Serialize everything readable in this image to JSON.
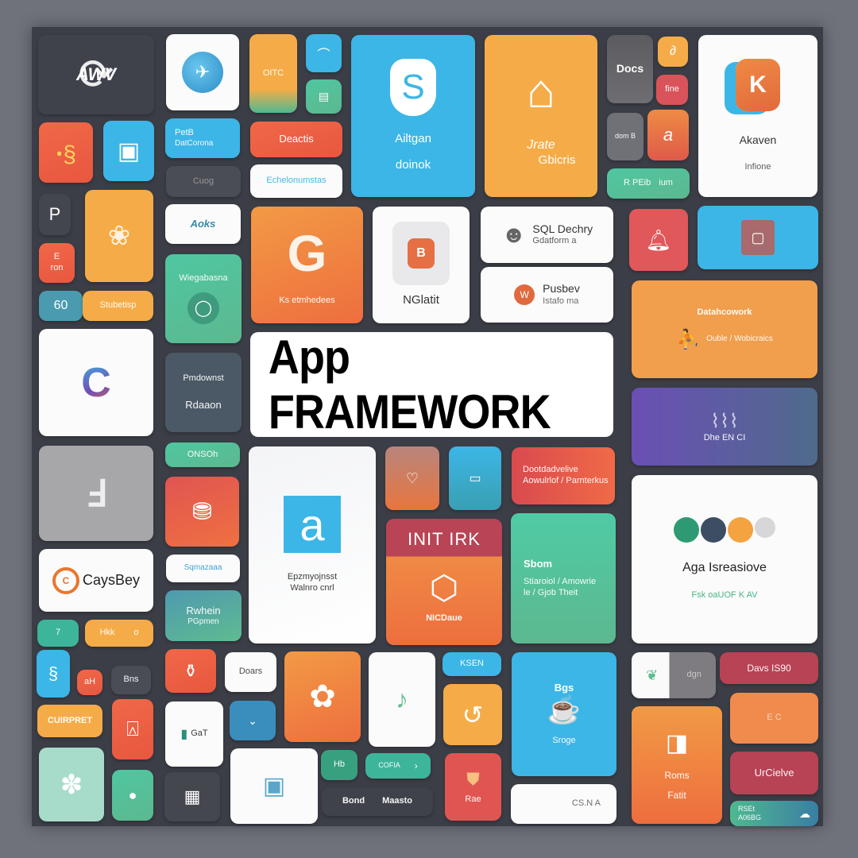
{
  "title": "App FRAMEWORK",
  "colors": {
    "background": "#6f717b",
    "panel": "#3c3e47",
    "orange": "#ee6e3e",
    "yellow": "#f5ac48",
    "blue": "#3cb6e6",
    "green": "#4fc7a1",
    "crimson": "#b74355",
    "white": "#fbfbfb"
  },
  "tiles": {
    "awv_logo": {
      "label": "AWV",
      "icon": "refresh-cycle-icon"
    },
    "globe_app": {
      "icon": "globe-icon"
    },
    "orange_small_top": {
      "label": "OITC"
    },
    "blue_small_top": {
      "icon": "pen-icon"
    },
    "green_small_top": {
      "icon": "card-icon"
    },
    "ailtgan": {
      "label": "Ailtgan",
      "sub": "doinok",
      "icon": "s-shape-icon"
    },
    "jrate": {
      "label": "Jrate",
      "sub": "Gbicris",
      "icon": "building-icon"
    },
    "docs_dark": {
      "label": "Docs"
    },
    "small_orange_d": {
      "icon": "link-icon"
    },
    "small_red_fine": {
      "label": "fine"
    },
    "small_grey_dom": {
      "label": "dom B"
    },
    "small_orange_a": {
      "label": "a"
    },
    "green_rpeib": {
      "label": "R PEib",
      "sub": "ium"
    },
    "akaven": {
      "label": "Akaven",
      "sub": "Infione",
      "icon": "k-bubble-icon"
    },
    "orange_square_1": {
      "icon": "mascot-icon"
    },
    "blue_square_1": {
      "icon": "document-icon"
    },
    "blue_peib": {
      "label": "PetB",
      "sub": "DatCorona"
    },
    "orange_deactis": {
      "label": "Deactis"
    },
    "grey_cuog": {
      "label": "Cuog"
    },
    "white_link": {
      "label": "Echelonumstas"
    },
    "dark_p": {
      "label": "P"
    },
    "yellow_flower": {
      "icon": "flower-icon"
    },
    "orange_e_ron": {
      "label": "E",
      "sub": "ron"
    },
    "white_aoks": {
      "label": "Aoks"
    },
    "green_wiegab": {
      "label": "Wiegabasna",
      "icon": "chat-bubble-icon"
    },
    "orange_g_big": {
      "label": "Ks etmhedees",
      "icon": "g-letter-icon"
    },
    "white_b_card": {
      "label": "NGlatit",
      "icon": "b-square-icon"
    },
    "white_sql": {
      "label": "SQL Dechry",
      "sub": "Gdatform a",
      "icon": "head-icon"
    },
    "white_pusbev": {
      "label": "Pusbev",
      "sub": "Istafo ma",
      "icon": "avatar-icon"
    },
    "red_square": {
      "icon": "bell-icon"
    },
    "blue_wide_right": {
      "icon": "window-icon"
    },
    "orange_datafrance": {
      "label": "Datahcowork",
      "sub": "Ouble / Wobicraics",
      "icon": "runner-icon"
    },
    "teal_60": {
      "label": "60"
    },
    "yellow_studio": {
      "label": "Stubetisp"
    },
    "white_c_logo": {
      "icon": "c-logo-icon"
    },
    "dark_pmdownst": {
      "label": "Pmdownst",
      "sub": "Rdaaon"
    },
    "purple_wire": {
      "label": "Dhe EN CI",
      "icon": "wireframe-icon"
    },
    "green_onsoh": {
      "label": "ONSOh"
    },
    "grey_l_logo": {
      "icon": "l-logo-icon"
    },
    "red_tags": {
      "icon": "tag-icon"
    },
    "white_a_card": {
      "label": "Epzmyojnsst",
      "sub": "Walnro cnrl",
      "icon": "a-letter-icon"
    },
    "orange_heart": {
      "icon": "heart-icon"
    },
    "blue_box": {
      "icon": "box-icon"
    },
    "red_pooteb": {
      "label": "Dootdadvelive",
      "sub": "Aowulrlof / Parnterkus"
    },
    "init_irk": {
      "label": "INIT IRK",
      "sub": "NICDaue",
      "icon": "hexagon-icon"
    },
    "green_sbom": {
      "label": "Sbom",
      "sub": "Stiaroiol / Amowrie le / Gjob Theit"
    },
    "white_aga": {
      "label": "Aga Isreasiove",
      "sub": "Fsk oaUOF K AV",
      "icon": "puzzle-icon"
    },
    "white_caysbey": {
      "label": "CaysBey",
      "icon": "c-circle-icon"
    },
    "white_link2": {
      "label": "Sqmazaaa"
    },
    "green_rwhein": {
      "label": "Rwhein",
      "sub": "PGpmen"
    },
    "teal_small_bottom": {
      "label": "7"
    },
    "yellow_hk": {
      "label": "Hkk",
      "sub": "o"
    },
    "blue_sm_b": {
      "icon": "s-scroll-icon"
    },
    "orange_ah": {
      "label": "aH"
    },
    "dark_bns": {
      "label": "Bns"
    },
    "orange_bottle": {
      "icon": "bottle-icon"
    },
    "white_doars": {
      "label": "Doars"
    },
    "orange_fox": {
      "icon": "fox-icon"
    },
    "white_note": {
      "icon": "music-note-icon"
    },
    "blue_ksen": {
      "label": "KSEN"
    },
    "blue_big_bot": {
      "label": "Sroge",
      "sub": "Bgs",
      "icon": "pot-icon"
    },
    "white_dgn": {
      "label": "dgn"
    },
    "crim_davs": {
      "label": "Davs IS90"
    },
    "yellow_cuirpt": {
      "label": "CUIRPRET"
    },
    "orange_frame": {
      "icon": "frame-icon"
    },
    "white_gaff": {
      "label": "GaT",
      "icon": "cup-icon"
    },
    "blue_check": {
      "icon": "chevron-down-icon"
    },
    "yellow_circle": {
      "icon": "rotate-icon"
    },
    "red_rae": {
      "label": "Rae",
      "icon": "shield-icon"
    },
    "white_wide_bot": {
      "label": "CS.N A"
    },
    "orange_roms": {
      "label": "Roms",
      "sub": "Fatit",
      "icon": "door-icon"
    },
    "orange_wide_right": {
      "label": "E C"
    },
    "crim_urciewe": {
      "label": "UrCielve"
    },
    "teal_gradient_bot": {
      "label": "RSEt",
      "sub": "A06BG",
      "icon": "cloud-icon"
    },
    "mint_flower": {
      "icon": "flower-icon"
    },
    "green_pear": {
      "icon": "pear-icon"
    },
    "dark_folder": {
      "icon": "folder-stack-icon"
    },
    "white_card_bot": {
      "icon": "dashboard-icon"
    },
    "green_hb": {
      "label": "Hb"
    },
    "teal_cofia": {
      "label": "COFIA"
    },
    "dark_bond": {
      "label": "Bond",
      "sub": "Maasto"
    }
  }
}
